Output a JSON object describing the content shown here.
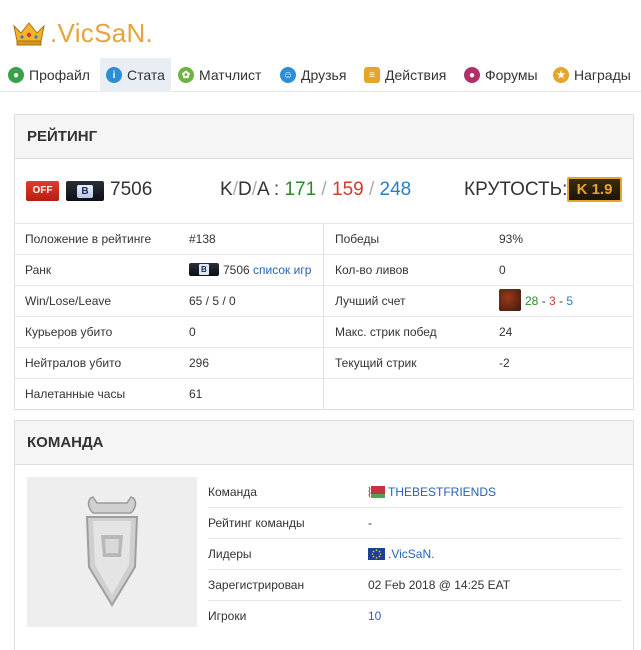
{
  "header": {
    "title": ".VicSaN.",
    "crown_icon": "crown-icon"
  },
  "tabs": [
    {
      "label": "Профайл",
      "icon": "profile-icon",
      "color": "#3aa14a"
    },
    {
      "label": "Стата",
      "icon": "stats-icon",
      "color": "#2c8fd6"
    },
    {
      "label": "Матчлист",
      "icon": "matchlist-icon",
      "color": "#6db33f"
    },
    {
      "label": "Друзья",
      "icon": "friends-icon",
      "color": "#2c8fd6"
    },
    {
      "label": "Действия",
      "icon": "actions-icon",
      "color": "#e6a52a"
    },
    {
      "label": "Форумы",
      "icon": "forums-icon",
      "color": "#b0306a"
    },
    {
      "label": "Награды",
      "icon": "awards-icon",
      "color": "#e6a52a"
    }
  ],
  "rating": {
    "heading": "РЕЙТИНГ",
    "off_label": "OFF",
    "rank_letter": "B",
    "rating_value": "7506",
    "kda_label": "K/D/A :",
    "kda_k": "K",
    "kda_d": "D",
    "kda_a": "A",
    "kills": "171",
    "deaths": "159",
    "assists": "248",
    "krutost_label": "КРУТОСТЬ:",
    "krutost_value": "K 1.9"
  },
  "stats": {
    "position_label": "Положение в рейтинге",
    "position_value": "#138",
    "rank_label": "Ранк",
    "rank_value": "7506",
    "rank_link": "список игр",
    "wll_label": "Win/Lose/Leave",
    "wll_value": "65 / 5 / 0",
    "couriers_label": "Курьеров убито",
    "couriers_value": "0",
    "neutrals_label": "Нейтралов убито",
    "neutrals_value": "296",
    "hours_label": "Налетанные часы",
    "hours_value": "61",
    "wins_label": "Победы",
    "wins_value": "93%",
    "leaves_label": "Кол-во ливов",
    "leaves_value": "0",
    "best_label": "Лучший счет",
    "best_k": "28",
    "best_d": "3",
    "best_a": "5",
    "best_sep": "-",
    "streak_max_label": "Макс. стрик побед",
    "streak_max_value": "24",
    "streak_cur_label": "Текущий стрик",
    "streak_cur_value": "-2"
  },
  "team": {
    "heading": "КОМАНДА",
    "team_label": "Команда",
    "team_value": "THEBESTFRIENDS",
    "team_rating_label": "Рейтинг команды",
    "team_rating_value": "-",
    "leaders_label": "Лидеры",
    "leaders_value": ".VicSaN.",
    "registered_label": "Зарегистрирован",
    "registered_value": "02 Feb 2018 @ 14:25 EAT",
    "players_label": "Игроки",
    "players_value": "10"
  },
  "colors": {
    "accent": "#e8a33a",
    "link": "#2563b8",
    "kills": "#2a8a2a",
    "deaths": "#d23a2a",
    "assists": "#2c7fbf"
  }
}
